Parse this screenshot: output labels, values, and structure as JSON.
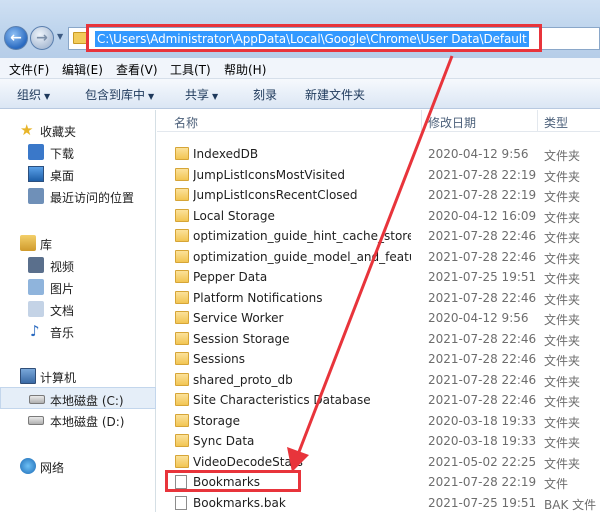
{
  "address": {
    "path": "C:\\Users\\Administrator\\AppData\\Local\\Google\\Chrome\\User Data\\Default"
  },
  "menu": [
    "文件(F)",
    "编辑(E)",
    "查看(V)",
    "工具(T)",
    "帮助(H)"
  ],
  "toolbar": {
    "organize": "组织",
    "include": "包含到库中",
    "share": "共享",
    "burn": "刻录",
    "new_folder": "新建文件夹"
  },
  "nav": {
    "favorites": "收藏夹",
    "downloads": "下载",
    "desktop": "桌面",
    "recent": "最近访问的位置",
    "libraries": "库",
    "videos": "视频",
    "pictures": "图片",
    "documents": "文档",
    "music": "音乐",
    "computer": "计算机",
    "disk_c": "本地磁盘 (C:)",
    "disk_d": "本地磁盘 (D:)",
    "network": "网络"
  },
  "columns": {
    "name": "名称",
    "date": "修改日期",
    "type": "类型"
  },
  "files": [
    {
      "name": "IndexedDB",
      "date": "2020-04-12 9:56",
      "type": "文件夹",
      "kind": "folder"
    },
    {
      "name": "JumpListIconsMostVisited",
      "date": "2021-07-28 22:19",
      "type": "文件夹",
      "kind": "folder"
    },
    {
      "name": "JumpListIconsRecentClosed",
      "date": "2021-07-28 22:19",
      "type": "文件夹",
      "kind": "folder"
    },
    {
      "name": "Local Storage",
      "date": "2020-04-12 16:09",
      "type": "文件夹",
      "kind": "folder"
    },
    {
      "name": "optimization_guide_hint_cache_store",
      "date": "2021-07-28 22:46",
      "type": "文件夹",
      "kind": "folder"
    },
    {
      "name": "optimization_guide_model_and_featu...",
      "date": "2021-07-28 22:46",
      "type": "文件夹",
      "kind": "folder"
    },
    {
      "name": "Pepper Data",
      "date": "2021-07-25 19:51",
      "type": "文件夹",
      "kind": "folder"
    },
    {
      "name": "Platform Notifications",
      "date": "2021-07-28 22:46",
      "type": "文件夹",
      "kind": "folder"
    },
    {
      "name": "Service Worker",
      "date": "2020-04-12 9:56",
      "type": "文件夹",
      "kind": "folder"
    },
    {
      "name": "Session Storage",
      "date": "2021-07-28 22:46",
      "type": "文件夹",
      "kind": "folder"
    },
    {
      "name": "Sessions",
      "date": "2021-07-28 22:46",
      "type": "文件夹",
      "kind": "folder"
    },
    {
      "name": "shared_proto_db",
      "date": "2021-07-28 22:46",
      "type": "文件夹",
      "kind": "folder"
    },
    {
      "name": "Site Characteristics Database",
      "date": "2021-07-28 22:46",
      "type": "文件夹",
      "kind": "folder"
    },
    {
      "name": "Storage",
      "date": "2020-03-18 19:33",
      "type": "文件夹",
      "kind": "folder"
    },
    {
      "name": "Sync Data",
      "date": "2020-03-18 19:33",
      "type": "文件夹",
      "kind": "folder"
    },
    {
      "name": "VideoDecodeStats",
      "date": "2021-05-02 22:25",
      "type": "文件夹",
      "kind": "folder"
    },
    {
      "name": "Bookmarks",
      "date": "2021-07-28 22:19",
      "type": "文件",
      "kind": "file"
    },
    {
      "name": "Bookmarks.bak",
      "date": "2021-07-25 19:51",
      "type": "BAK 文件",
      "kind": "file"
    }
  ],
  "colors": {
    "highlight": "#3399ff",
    "annotation": "#e8343b"
  }
}
